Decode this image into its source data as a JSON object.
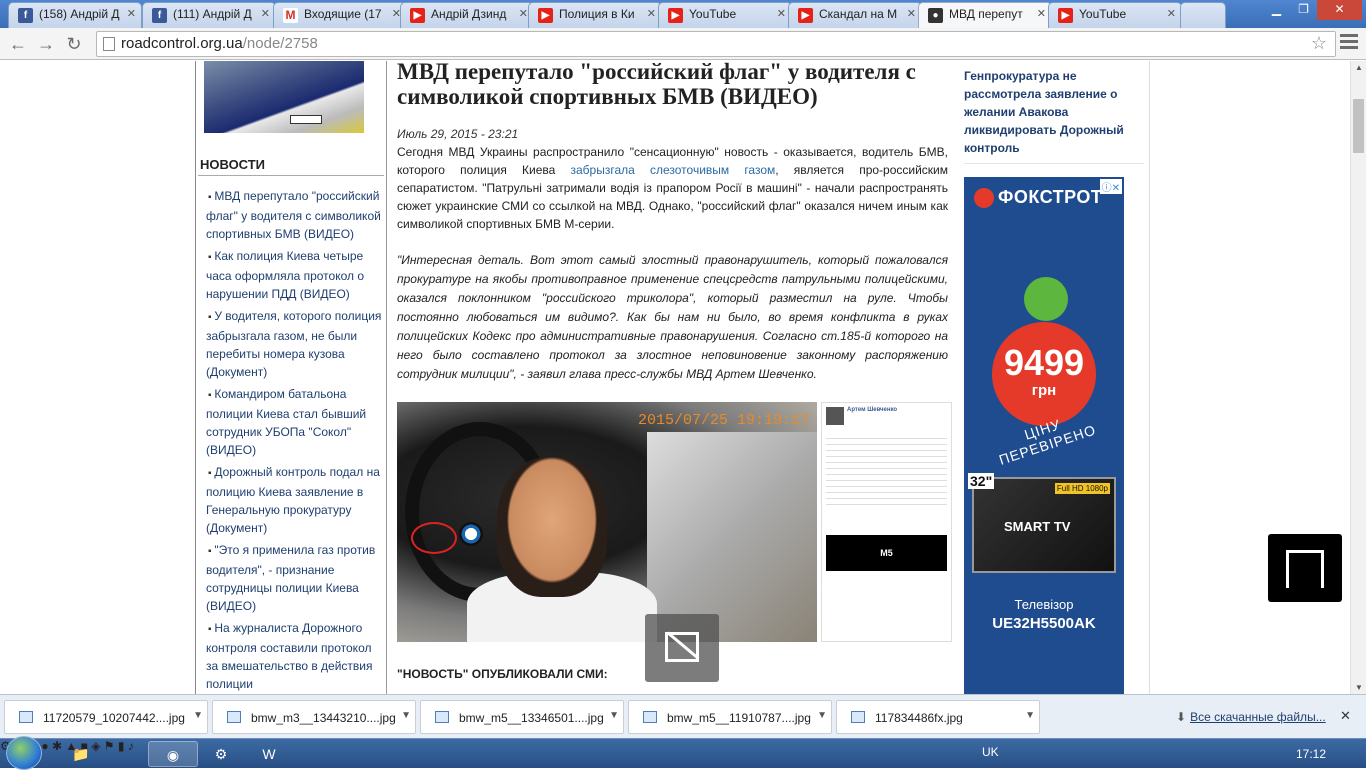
{
  "browser": {
    "tabs": [
      {
        "label": "(158) Андрій Д",
        "favicon": "facebook-icon",
        "active": false
      },
      {
        "label": "(111) Андрій Д",
        "favicon": "facebook-icon",
        "active": false
      },
      {
        "label": "Входящие (17",
        "favicon": "gmail-icon",
        "active": false
      },
      {
        "label": "Андрій Дзинд",
        "favicon": "youtube-icon",
        "active": false
      },
      {
        "label": "Полиция в Ки",
        "favicon": "youtube-icon",
        "active": false
      },
      {
        "label": "YouTube",
        "favicon": "youtube-icon",
        "active": false
      },
      {
        "label": "Скандал на М",
        "favicon": "youtube-icon",
        "active": false
      },
      {
        "label": "МВД перепут",
        "favicon": "roadcontrol-icon",
        "active": true
      },
      {
        "label": "YouTube",
        "favicon": "youtube-icon",
        "active": false
      }
    ],
    "url_host": "roadcontrol.org.ua",
    "url_path": "/node/2758"
  },
  "sidebar_left": {
    "news_heading": "НОВОСТИ",
    "news_items": [
      "МВД перепутало \"российский флаг\" у водителя с символикой спортивных БМВ (ВИДЕО)",
      "Как полиция Киева четыре часа оформляла протокол о нарушении ПДД (ВИДЕО)",
      "У водителя, которого полиция забрызгала газом, не были перебиты номера кузова (Документ)",
      "Командиром батальона полиции Киева стал бывший сотрудник УБОПа \"Сокол\" (ВИДЕО)",
      "Дорожный контроль подал на полицию Киева заявление в Генеральную прокуратуру (Документ)",
      "\"Это я применила газ против водителя\", - признание сотрудницы полиции Киева (ВИДЕО)",
      "На журналиста Дорожного контроля составили протокол за вмешательство в действия полиции"
    ]
  },
  "article": {
    "title": "МВД перепутало \"российский флаг\" у водителя с символикой спортивных БМВ (ВИДЕО)",
    "date": "Июль 29, 2015 - 23:21",
    "lead_before": "Сегодня МВД Украины распространило \"сенсационную\" новость - оказывается, водитель БМВ, которого полиция Киева ",
    "lead_link": "забрызгала слезоточивым газом",
    "lead_after": ", является про-российским сепаратистом. \"Патрульні затримали водія із прапором Росії в машині\" - начали распространять сюжет украинские СМИ со ссылкой на МВД. Однако, \"российский флаг\" оказался ничем иным как символикой спортивных БМВ М-серии.",
    "quote": "\"Интересная деталь. Вот этот самый злостный правонарушитель, который пожаловался прокуратуре на якобы противоправное применение спецсредств патрульными полицейскими, оказался поклонником \"российского триколора\", который разместил на руле. Чтобы постоянно любоваться им видимо?. Как бы нам ни было, во время конфликта в руках полицейских Кодекс про административные правонарушения. Согласно ст.185-й которого на него было составлено протокол за злостное неповиновение законному распоряжению сотрудник милиции\",",
    "quote_attr": " - заявил глава пресс-службы МВД Артем Шевченко.",
    "photo_timestamp": "2015/07/25 19:19:17",
    "fb_name": "Артем Шевченко",
    "fb_m5": "M5",
    "subheading": "\"НОВОСТЬ\" ОПУБЛИКОВАЛИ СМИ:"
  },
  "sidebar_right": {
    "link": "Генпрокуратура не рассмотрела заявление о желании Авакова ликвидировать Дорожный контроль",
    "ad": {
      "brand": "ФОКСТРОТ",
      "price": "9499",
      "currency": "грн",
      "slogan": "ЦІНУ ПЕРЕВІРЕНО",
      "tv_size": "32\"",
      "tv_label": "SMART TV",
      "tv_badge": "Full HD 1080p",
      "model_line1": "Телевізор",
      "model_line2": "UE32H5500AK",
      "ad_badge": "ⓘ✕"
    }
  },
  "downloads": {
    "items": [
      "11720579_10207442....jpg",
      "bmw_m3__13443210....jpg",
      "bmw_m5__13346501....jpg",
      "bmw_m5__11910787....jpg",
      "117834486fx.jpg"
    ],
    "all_files": "Все скачанные файлы...",
    "close": "✕"
  },
  "taskbar": {
    "lang": "UK",
    "clock": "17:12"
  },
  "colors": {
    "link": "#1f3f70",
    "ad_bg": "#1f4c8e",
    "price_badge": "#e53a2a"
  }
}
